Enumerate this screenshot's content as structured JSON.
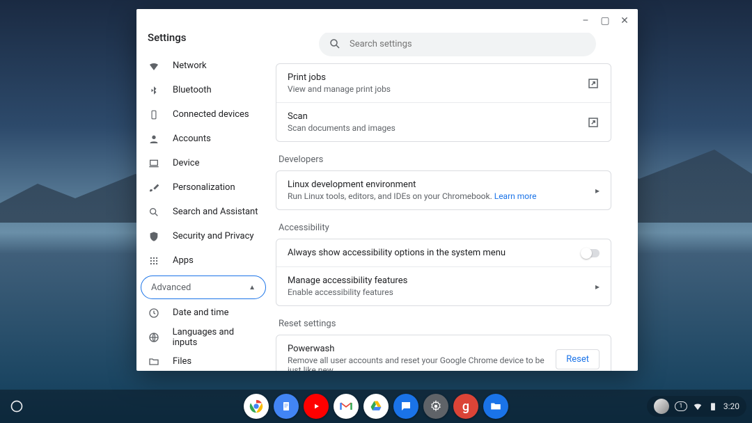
{
  "window": {
    "title": "Settings",
    "controls": {
      "min": "–",
      "max": "▢",
      "close": "✕"
    }
  },
  "search": {
    "placeholder": "Search settings"
  },
  "sidebar": {
    "items": [
      {
        "id": "network",
        "label": "Network"
      },
      {
        "id": "bluetooth",
        "label": "Bluetooth"
      },
      {
        "id": "connected-devices",
        "label": "Connected devices"
      },
      {
        "id": "accounts",
        "label": "Accounts"
      },
      {
        "id": "device",
        "label": "Device"
      },
      {
        "id": "personalization",
        "label": "Personalization"
      },
      {
        "id": "search-assistant",
        "label": "Search and Assistant"
      },
      {
        "id": "security-privacy",
        "label": "Security and Privacy"
      },
      {
        "id": "apps",
        "label": "Apps"
      }
    ],
    "advanced_label": "Advanced",
    "advanced_items": [
      {
        "id": "date-time",
        "label": "Date and time"
      },
      {
        "id": "languages-inputs",
        "label": "Languages and inputs"
      },
      {
        "id": "files",
        "label": "Files"
      }
    ]
  },
  "sections": {
    "print": {
      "rows": [
        {
          "title": "Print jobs",
          "sub": "View and manage print jobs",
          "ext": true
        },
        {
          "title": "Scan",
          "sub": "Scan documents and images",
          "ext": true
        }
      ]
    },
    "developers": {
      "heading": "Developers",
      "row": {
        "title": "Linux development environment",
        "sub": "Run Linux tools, editors, and IDEs on your Chromebook.",
        "link": "Learn more"
      }
    },
    "accessibility": {
      "heading": "Accessibility",
      "toggle_row": {
        "title": "Always show accessibility options in the system menu"
      },
      "manage_row": {
        "title": "Manage accessibility features",
        "sub": "Enable accessibility features"
      }
    },
    "reset": {
      "heading": "Reset settings",
      "row": {
        "title": "Powerwash",
        "sub": "Remove all user accounts and reset your Google Chrome device to be just like new.",
        "button": "Reset"
      }
    }
  },
  "shelf": {
    "apps": [
      {
        "id": "chrome",
        "bg": "#fff",
        "fg": "#333"
      },
      {
        "id": "docs",
        "bg": "#4285f4"
      },
      {
        "id": "youtube",
        "bg": "#ff0000"
      },
      {
        "id": "gmail",
        "bg": "#ffffff",
        "fg": "#ea4335"
      },
      {
        "id": "drive",
        "bg": "#ffffff"
      },
      {
        "id": "messages",
        "bg": "#1a73e8"
      },
      {
        "id": "settings",
        "bg": "#5f6368"
      },
      {
        "id": "app-g",
        "bg": "#db4437"
      },
      {
        "id": "files",
        "bg": "#1a73e8"
      }
    ],
    "tray": {
      "counter": "1",
      "time": "3:20"
    }
  }
}
